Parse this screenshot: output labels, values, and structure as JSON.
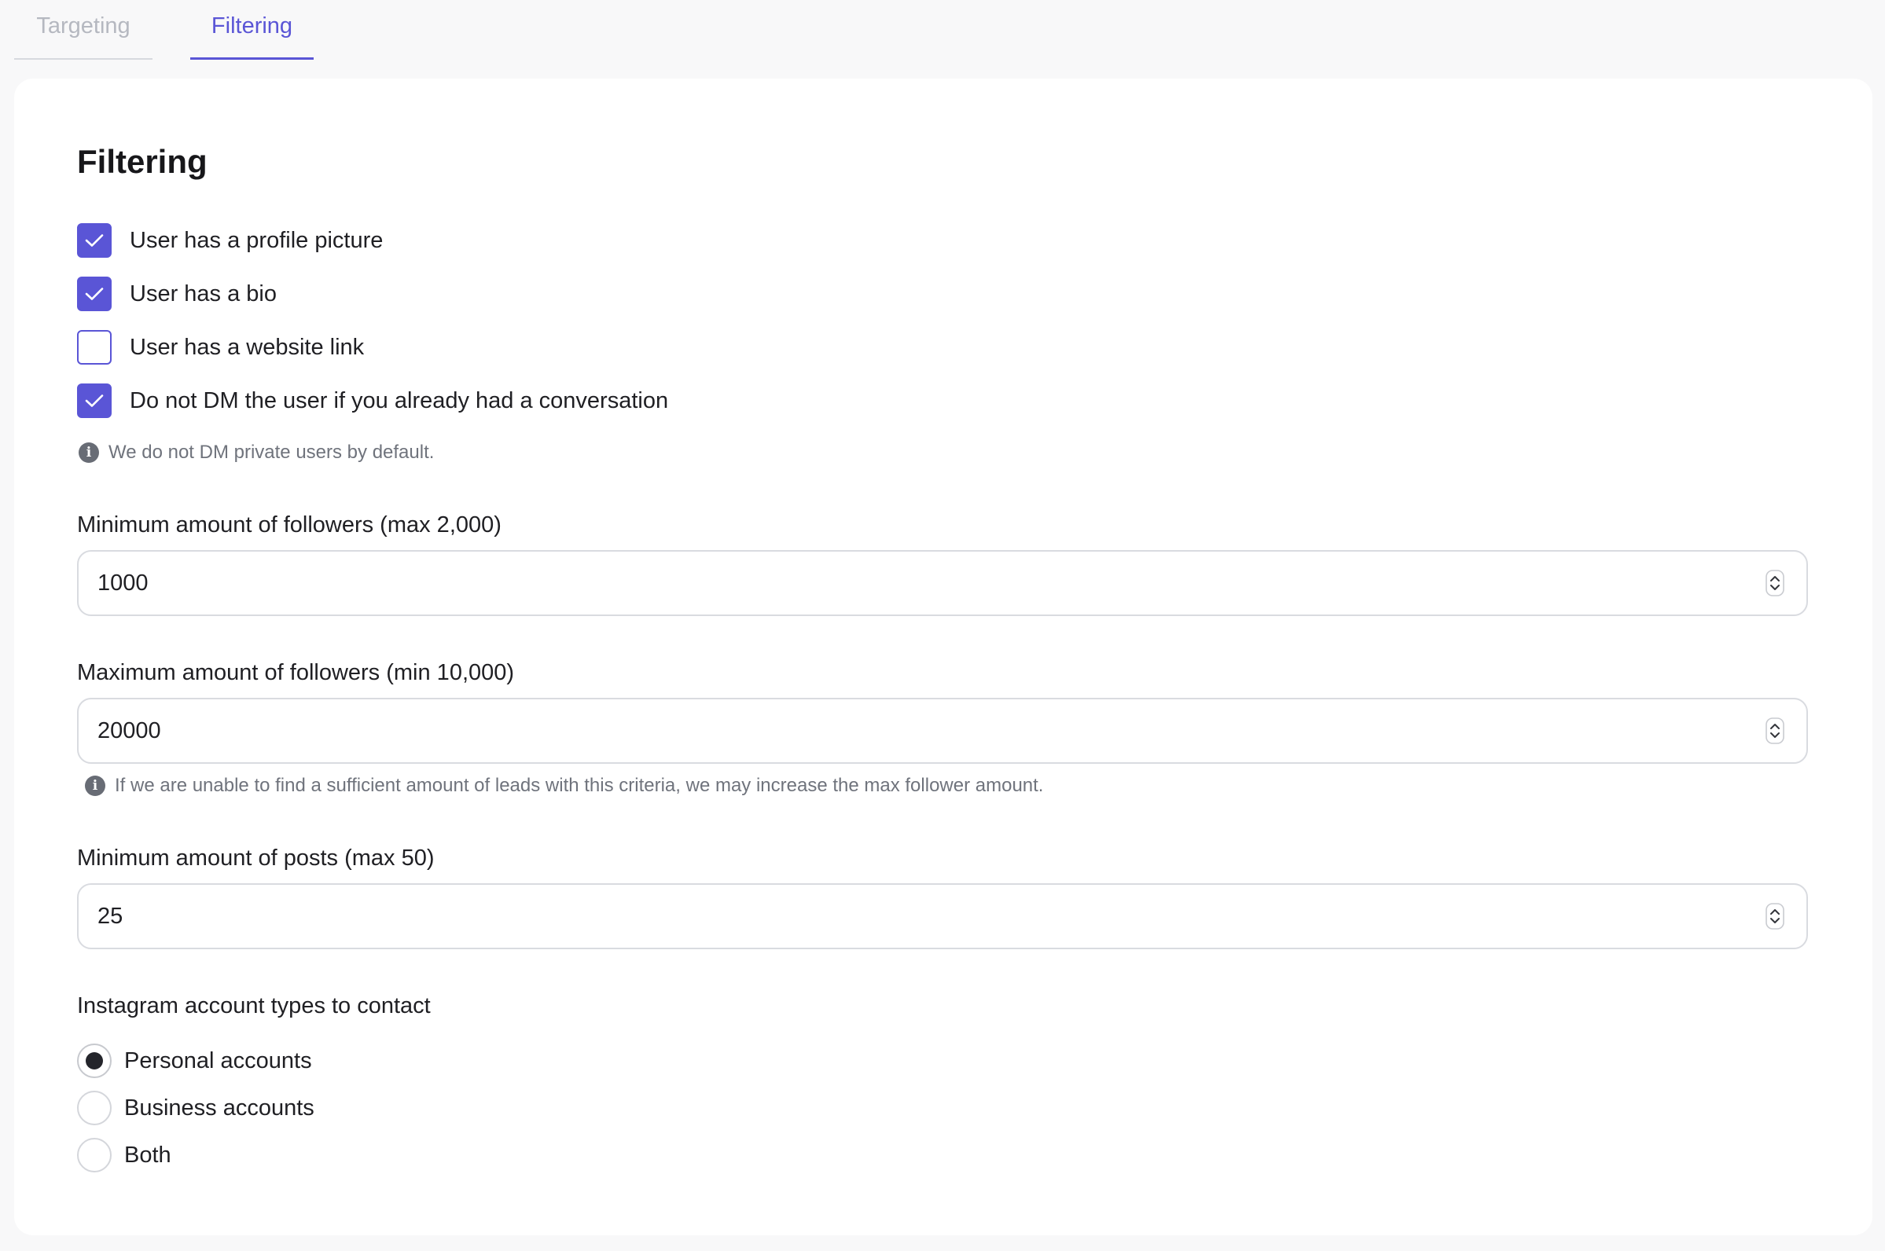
{
  "tabs": [
    {
      "label": "Targeting",
      "active": false
    },
    {
      "label": "Filtering",
      "active": true
    }
  ],
  "section": {
    "title": "Filtering"
  },
  "checkboxes": [
    {
      "label": "User has a profile picture",
      "checked": true
    },
    {
      "label": "User has a bio",
      "checked": true
    },
    {
      "label": "User has a website link",
      "checked": false
    },
    {
      "label": "Do not DM the user if you already had a conversation",
      "checked": true
    }
  ],
  "private_hint": "We do not DM private users by default.",
  "fields": [
    {
      "label": "Minimum amount of followers (max 2,000)",
      "value": "1000"
    },
    {
      "label": "Maximum amount of followers (min 10,000)",
      "value": "20000"
    },
    {
      "label": "Minimum amount of posts (max 50)",
      "value": "25"
    }
  ],
  "max_followers_hint": "If we are unable to find a sufficient amount of leads with this criteria, we may increase the max follower amount.",
  "account_types": {
    "label": "Instagram account types to contact",
    "options": [
      {
        "label": "Personal accounts",
        "selected": true
      },
      {
        "label": "Business accounts",
        "selected": false
      },
      {
        "label": "Both",
        "selected": false
      }
    ]
  },
  "colors": {
    "accent": "#5a55d6",
    "background": "#f8f8f9",
    "card": "#ffffff",
    "muted_text": "#6f737c"
  },
  "icons": {
    "check": "check-icon",
    "info": "info-icon",
    "spinner": "spinner-arrows-icon"
  }
}
